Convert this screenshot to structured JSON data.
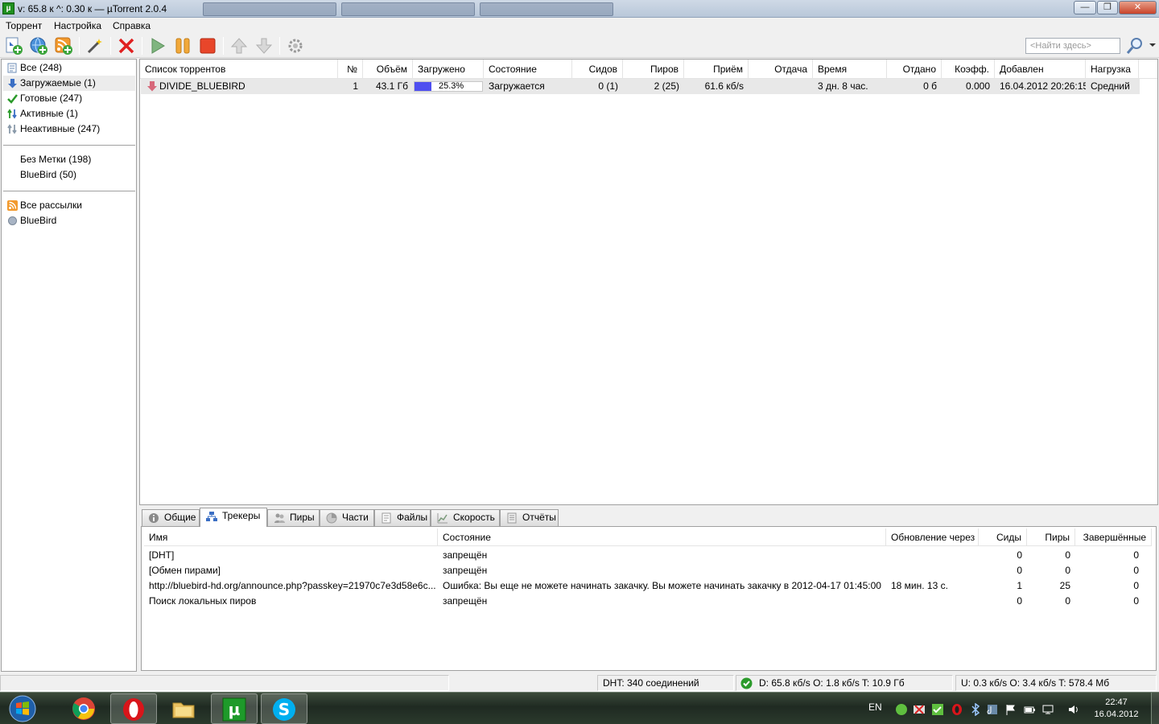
{
  "window": {
    "title": "v: 65.8 к ^: 0.30 к — µTorrent 2.0.4",
    "app_icon_glyph": "µ"
  },
  "menu": [
    "Торрент",
    "Настройка",
    "Справка"
  ],
  "toolbar": {
    "icons": [
      "add-torrent-icon",
      "add-url-icon",
      "add-rss-icon",
      "create-torrent-icon",
      "remove-icon",
      "start-icon",
      "pause-icon",
      "stop-icon",
      "move-up-icon",
      "move-down-icon",
      "settings-icon"
    ],
    "search_placeholder": "<Найти здесь>"
  },
  "sidebar": {
    "status_items": [
      {
        "label": "Все (248)",
        "icon": "all-icon"
      },
      {
        "label": "Загружаемые (1)",
        "icon": "download-arrow-icon",
        "selected": true
      },
      {
        "label": "Готовые (247)",
        "icon": "checkmark-icon"
      },
      {
        "label": "Активные (1)",
        "icon": "active-arrows-icon"
      },
      {
        "label": "Неактивные (247)",
        "icon": "inactive-arrows-icon"
      }
    ],
    "label_items": [
      {
        "label": "Без Метки (198)"
      },
      {
        "label": "BlueBird (50)"
      }
    ],
    "feed_items": [
      {
        "label": "Все рассылки",
        "icon": "rss-icon"
      },
      {
        "label": "BlueBird",
        "icon": "feed-circle-icon"
      }
    ]
  },
  "torrent_list": {
    "columns": [
      "Список торрентов",
      "№",
      "Объём",
      "Загружено",
      "Состояние",
      "Сидов",
      "Пиров",
      "Приём",
      "Отдача",
      "Время",
      "Отдано",
      "Коэфф.",
      "Добавлен",
      "Нагрузка"
    ],
    "rows": [
      {
        "name": "DIVIDE_BLUEBIRD",
        "num": "1",
        "size": "43.1 Гб",
        "progress_text": "25.3%",
        "progress": 0.253,
        "status": "Загружается",
        "seeds": "0 (1)",
        "peers": "2 (25)",
        "down_speed": "61.6 кб/s",
        "up_speed": "",
        "eta": "3 дн. 8 час.",
        "uploaded": "0 б",
        "ratio": "0.000",
        "added": "16.04.2012 20:26:15",
        "availability": "Средний"
      }
    ]
  },
  "detail_tabs": [
    {
      "label": "Общие",
      "icon": "info-icon"
    },
    {
      "label": "Трекеры",
      "icon": "trackers-icon",
      "active": true
    },
    {
      "label": "Пиры",
      "icon": "peers-icon"
    },
    {
      "label": "Части",
      "icon": "pieces-icon"
    },
    {
      "label": "Файлы",
      "icon": "files-icon"
    },
    {
      "label": "Скорость",
      "icon": "speed-graph-icon"
    },
    {
      "label": "Отчёты",
      "icon": "logger-icon"
    }
  ],
  "trackers": {
    "columns": [
      "Имя",
      "Состояние",
      "Обновление через",
      "Сиды",
      "Пиры",
      "Завершённые"
    ],
    "rows": [
      {
        "name": "[DHT]",
        "status": "запрещён",
        "update_in": "",
        "seeds": "0",
        "peers": "0",
        "completed": "0"
      },
      {
        "name": "[Обмен пирами]",
        "status": "запрещён",
        "update_in": "",
        "seeds": "0",
        "peers": "0",
        "completed": "0"
      },
      {
        "name": "http://bluebird-hd.org/announce.php?passkey=21970c7e3d58e6c...",
        "status": "Ошибка: Вы еще не можете начинать закачку. Вы можете начинать закачку в 2012-04-17 01:45:00",
        "update_in": "18 мин. 13 с.",
        "seeds": "1",
        "peers": "25",
        "completed": "0"
      },
      {
        "name": "Поиск локальных пиров",
        "status": "запрещён",
        "update_in": "",
        "seeds": "0",
        "peers": "0",
        "completed": "0"
      }
    ]
  },
  "statusbar": {
    "dht": "DHT: 340 соединений",
    "download": "D: 65.8 кб/s O: 1.8 кб/s T: 10.9 Гб",
    "upload": "U: 0.3 кб/s O: 3.4 кб/s T: 578.4 Мб"
  },
  "taskbar": {
    "apps": [
      "chrome-icon",
      "opera-icon",
      "explorer-folder-icon",
      "utorrent-icon",
      "skype-icon"
    ],
    "language": "EN",
    "time": "22:47",
    "date": "16.04.2012"
  },
  "colors": {
    "progress_fill": "#4f4ff0",
    "selected_row": "#e8e8e8",
    "utorrent_green": "#1e8f1e"
  }
}
